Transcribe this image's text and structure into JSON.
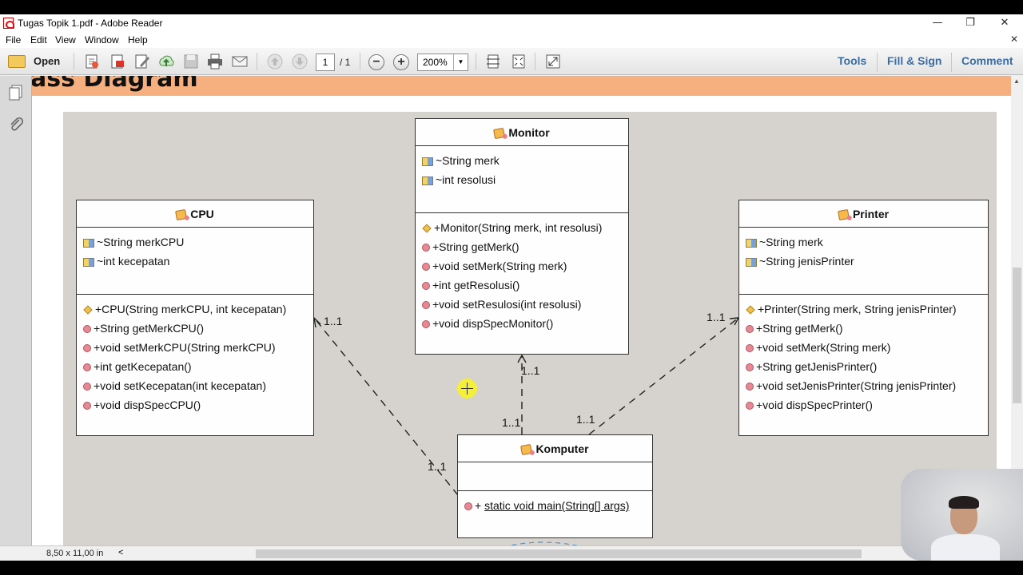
{
  "window": {
    "title": "Tugas Topik 1.pdf - Adobe Reader",
    "controls": [
      "—",
      "❐",
      "✕"
    ]
  },
  "menu": [
    "File",
    "Edit",
    "View",
    "Window",
    "Help"
  ],
  "toolbar": {
    "open_label": "Open",
    "page_current": "1",
    "page_total": "/ 1",
    "zoom": "200%",
    "tools_label": "Tools",
    "fill_sign_label": "Fill & Sign",
    "comment_label": "Comment"
  },
  "document": {
    "heading": "ass Diagram"
  },
  "diagram": {
    "classes": {
      "monitor": {
        "name": "Monitor",
        "attributes": [
          "~String merk",
          "~int resolusi"
        ],
        "constructor": "+Monitor(String merk, int resolusi)",
        "methods": [
          "+String getMerk()",
          "+void setMerk(String merk)",
          "+int getResolusi()",
          "+void setResulosi(int resolusi)",
          "+void dispSpecMonitor()"
        ]
      },
      "cpu": {
        "name": "CPU",
        "attributes": [
          "~String merkCPU",
          "~int kecepatan"
        ],
        "constructor": "+CPU(String merkCPU, int kecepatan)",
        "methods": [
          "+String getMerkCPU()",
          "+void setMerkCPU(String merkCPU)",
          "+int getKecepatan()",
          "+void setKecepatan(int kecepatan)",
          "+void dispSpecCPU()"
        ]
      },
      "printer": {
        "name": "Printer",
        "attributes": [
          "~String merk",
          "~String jenisPrinter"
        ],
        "constructor": "+Printer(String merk, String jenisPrinter)",
        "methods": [
          "+String getMerk()",
          "+void setMerk(String merk)",
          "+String getJenisPrinter()",
          "+void setJenisPrinter(String jenisPrinter)",
          "+void dispSpecPrinter()"
        ]
      },
      "komputer": {
        "name": "Komputer",
        "method_prefix": "+",
        "method": "static void main(String[] args)"
      }
    },
    "multiplicities": {
      "cpu_end": "1..1",
      "cpu_komputer_end": "1..1",
      "monitor_end": "1..1",
      "monitor_komputer_end": "1..1",
      "printer_end": "1..1",
      "printer_komputer_end": "1..1"
    }
  },
  "status": {
    "page_size": "8,50 x 11,00 in",
    "scroll_left": "<"
  }
}
